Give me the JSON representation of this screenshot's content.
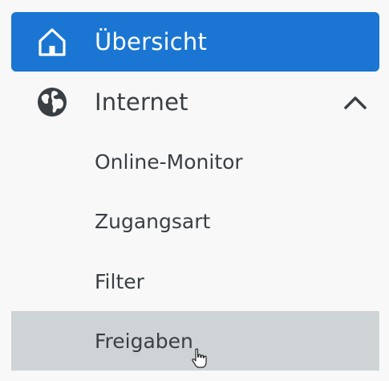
{
  "nav": {
    "overview": {
      "label": "Übersicht",
      "icon": "home-icon",
      "active": true
    },
    "internet": {
      "label": "Internet",
      "icon": "globe-icon",
      "expanded": true,
      "toggle_icon": "chevron-up-icon",
      "children": [
        {
          "label": "Online-Monitor"
        },
        {
          "label": "Zugangsart"
        },
        {
          "label": "Filter"
        },
        {
          "label": "Freigaben",
          "hovered": true
        }
      ]
    }
  },
  "colors": {
    "active_bg": "#1a76d2",
    "hover_bg": "#ced3d6",
    "text": "#3a3f44",
    "background": "#f8f8f8"
  }
}
